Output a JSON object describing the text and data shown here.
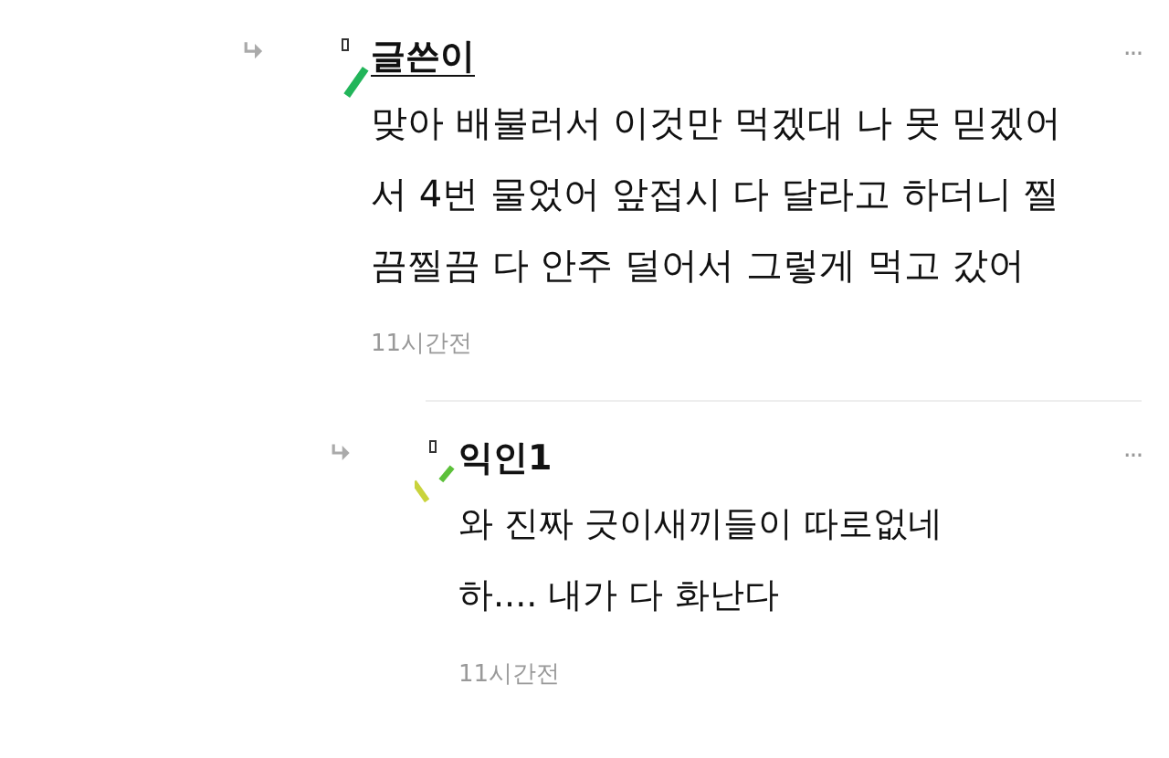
{
  "comments": [
    {
      "author": "글쓴이",
      "is_writer": true,
      "text": "맞아 배불러서 이것만 먹겠대 나 못 믿겠어\n서 4번 물었어 앞접시 다 달라고 하더니 찔\n끔찔끔 다 안주 덜어서 그렇게 먹고 갔어",
      "time": "11시간전",
      "more": "···",
      "children": [
        {
          "author": "익인1",
          "is_writer": false,
          "text": "와 진짜 긋이새끼들이 따로없네\n하.... 내가 다 화난다",
          "time": "11시간전",
          "more": "···"
        }
      ]
    }
  ]
}
